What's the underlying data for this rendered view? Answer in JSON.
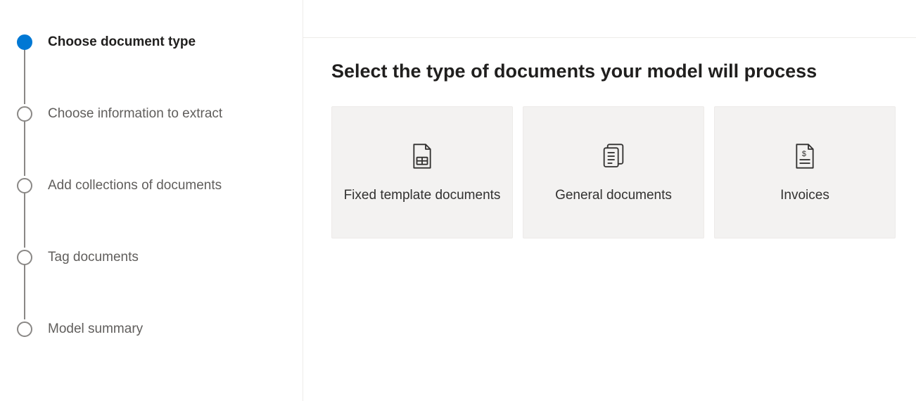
{
  "sidebar": {
    "steps": [
      {
        "label": "Choose document type",
        "active": true
      },
      {
        "label": "Choose information to extract",
        "active": false
      },
      {
        "label": "Add collections of documents",
        "active": false
      },
      {
        "label": "Tag documents",
        "active": false
      },
      {
        "label": "Model summary",
        "active": false
      }
    ]
  },
  "main": {
    "title": "Select the type of documents your model will process",
    "cards": [
      {
        "label": "Fixed template documents",
        "icon": "fixed-template-doc-icon"
      },
      {
        "label": "General documents",
        "icon": "general-doc-icon"
      },
      {
        "label": "Invoices",
        "icon": "invoice-doc-icon"
      }
    ]
  }
}
